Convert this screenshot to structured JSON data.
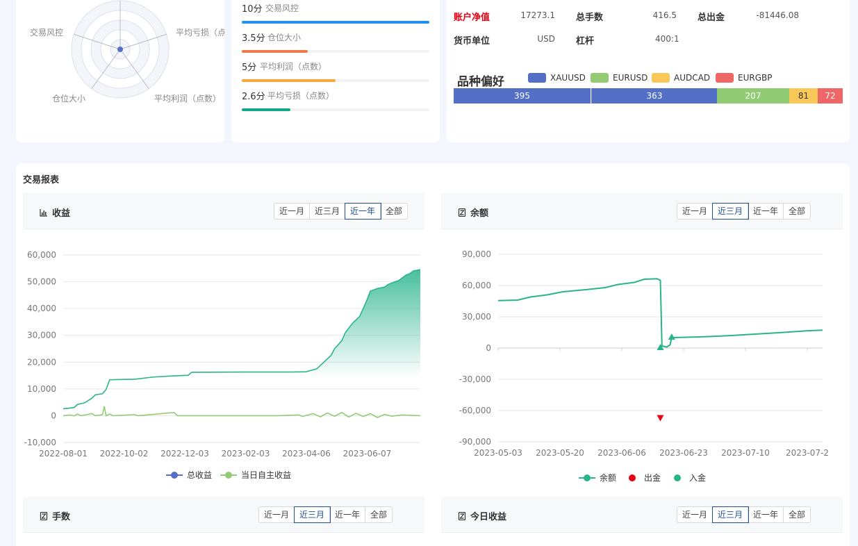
{
  "radar": {
    "labels": [
      "交易风控",
      "平均亏损（点",
      "平均利润（点数）",
      "仓位大小"
    ]
  },
  "scores": {
    "items": [
      {
        "score": "10分",
        "label": "交易风控",
        "fill": 1.0,
        "color": "#1e90f0"
      },
      {
        "score": "3.5分",
        "label": "仓位大小",
        "fill": 0.35,
        "color": "#f07a4a"
      },
      {
        "score": "5分",
        "label": "平均利润（点数）",
        "fill": 0.5,
        "color": "#f5a742"
      },
      {
        "score": "2.6分",
        "label": "平均亏损（点数）",
        "fill": 0.26,
        "color": "#12a88a"
      }
    ]
  },
  "account": {
    "net_value_label": "账户净值",
    "net_value": "17273.1",
    "total_lots_label": "总手数",
    "total_lots": "416.5",
    "total_withdraw_label": "总出金",
    "total_withdraw": "-81446.08",
    "currency_label": "货币单位",
    "currency": "USD",
    "leverage_label": "杠杆",
    "leverage": "400:1",
    "preference_title": "品种偏好",
    "legend": [
      {
        "name": "XAUUSD",
        "color": "#5470c6"
      },
      {
        "name": "EURUSD",
        "color": "#91cc75"
      },
      {
        "name": "AUDCAD",
        "color": "#fac858"
      },
      {
        "name": "EURGBP",
        "color": "#ee6666"
      }
    ],
    "segments": [
      {
        "value": "395",
        "color": "#5470c6"
      },
      {
        "value": "363",
        "color": "#5470c6"
      },
      {
        "value": "207",
        "color": "#91cc75"
      },
      {
        "value": "81",
        "color": "#fac858"
      },
      {
        "value": "72",
        "color": "#ee6666"
      }
    ]
  },
  "report": {
    "title": "交易报表",
    "ranges": [
      "近一月",
      "近三月",
      "近一年",
      "全部"
    ],
    "panels": {
      "profit": {
        "title": "收益",
        "active": 2
      },
      "balance": {
        "title": "余额",
        "active": 1
      },
      "lots": {
        "title": "手数",
        "active": 1
      },
      "today": {
        "title": "今日收益",
        "active": 1
      }
    }
  },
  "chart_data": [
    {
      "type": "line",
      "title": "收益",
      "ylim": [
        -10000,
        60000
      ],
      "yticks": [
        "60,000",
        "50,000",
        "40,000",
        "30,000",
        "20,000",
        "10,000",
        "0",
        "-10,000"
      ],
      "xticks": [
        "2022-08-01",
        "2022-10-02",
        "2022-12-03",
        "2023-02-03",
        "2023-04-06",
        "2023-06-07"
      ],
      "series": [
        {
          "name": "总收益",
          "color": "#5470c6",
          "line_color": "#28b48c",
          "values": [
            [
              0,
              2600
            ],
            [
              0.03,
              3000
            ],
            [
              0.04,
              4200
            ],
            [
              0.06,
              4800
            ],
            [
              0.08,
              6500
            ],
            [
              0.09,
              7800
            ],
            [
              0.11,
              8200
            ],
            [
              0.12,
              9800
            ],
            [
              0.13,
              13400
            ],
            [
              0.16,
              13500
            ],
            [
              0.2,
              13600
            ],
            [
              0.25,
              14400
            ],
            [
              0.3,
              14800
            ],
            [
              0.35,
              15100
            ],
            [
              0.36,
              16200
            ],
            [
              0.5,
              16300
            ],
            [
              0.64,
              16300
            ],
            [
              0.68,
              16400
            ],
            [
              0.71,
              17500
            ],
            [
              0.73,
              20000
            ],
            [
              0.75,
              22500
            ],
            [
              0.76,
              25000
            ],
            [
              0.78,
              28000
            ],
            [
              0.79,
              31000
            ],
            [
              0.81,
              34500
            ],
            [
              0.83,
              37000
            ],
            [
              0.84,
              40000
            ],
            [
              0.85,
              43000
            ],
            [
              0.86,
              46500
            ],
            [
              0.88,
              47500
            ],
            [
              0.9,
              48000
            ],
            [
              0.91,
              49000
            ],
            [
              0.92,
              49500
            ],
            [
              0.94,
              50500
            ],
            [
              0.95,
              51500
            ],
            [
              0.96,
              52500
            ],
            [
              0.97,
              53000
            ],
            [
              0.98,
              54000
            ],
            [
              1.0,
              54500
            ]
          ]
        },
        {
          "name": "当日自主收益",
          "color": "#91cc75",
          "values": [
            [
              0,
              0
            ],
            [
              0.02,
              300
            ],
            [
              0.03,
              -100
            ],
            [
              0.04,
              600
            ],
            [
              0.05,
              0
            ],
            [
              0.08,
              800
            ],
            [
              0.09,
              0
            ],
            [
              0.11,
              400
            ],
            [
              0.115,
              3500
            ],
            [
              0.12,
              0
            ],
            [
              0.13,
              600
            ],
            [
              0.14,
              0
            ],
            [
              0.2,
              400
            ],
            [
              0.21,
              0
            ],
            [
              0.31,
              1200
            ],
            [
              0.32,
              0
            ],
            [
              0.4,
              0
            ],
            [
              0.6,
              0
            ],
            [
              0.66,
              300
            ],
            [
              0.67,
              -300
            ],
            [
              0.7,
              800
            ],
            [
              0.72,
              -400
            ],
            [
              0.74,
              1000
            ],
            [
              0.76,
              -200
            ],
            [
              0.78,
              1200
            ],
            [
              0.8,
              -500
            ],
            [
              0.82,
              900
            ],
            [
              0.84,
              -300
            ],
            [
              0.86,
              800
            ],
            [
              0.88,
              -700
            ],
            [
              0.9,
              500
            ],
            [
              0.92,
              -200
            ],
            [
              0.95,
              300
            ],
            [
              1.0,
              0
            ]
          ]
        }
      ]
    },
    {
      "type": "line",
      "title": "余额",
      "ylim": [
        -90000,
        90000
      ],
      "yticks": [
        "90,000",
        "60,000",
        "30,000",
        "0",
        "-30,000",
        "-60,000",
        "-90,000"
      ],
      "xticks": [
        "2023-05-03",
        "2023-05-20",
        "2023-06-06",
        "2023-06-23",
        "2023-07-10",
        "2023-07-2"
      ],
      "series": [
        {
          "name": "余额",
          "color": "#27b48c",
          "values": [
            [
              0,
              45500
            ],
            [
              0.06,
              46000
            ],
            [
              0.1,
              49000
            ],
            [
              0.15,
              51000
            ],
            [
              0.2,
              54000
            ],
            [
              0.27,
              56000
            ],
            [
              0.33,
              58000
            ],
            [
              0.37,
              61000
            ],
            [
              0.42,
              63000
            ],
            [
              0.45,
              66000
            ],
            [
              0.49,
              66500
            ],
            [
              0.5,
              65000
            ],
            [
              0.505,
              2000
            ],
            [
              0.52,
              1000
            ],
            [
              0.53,
              3000
            ],
            [
              0.535,
              10000
            ],
            [
              0.6,
              10500
            ],
            [
              0.65,
              11000
            ],
            [
              0.72,
              12000
            ],
            [
              0.8,
              13500
            ],
            [
              0.88,
              15000
            ],
            [
              0.95,
              16500
            ],
            [
              1.0,
              17200
            ]
          ]
        },
        {
          "name": "出金",
          "color": "#e60012",
          "points": [
            [
              0.5,
              -67000
            ]
          ]
        },
        {
          "name": "入金",
          "color": "#27b48c",
          "points": [
            [
              0.5,
              0
            ],
            [
              0.535,
              10000
            ]
          ]
        }
      ]
    }
  ]
}
